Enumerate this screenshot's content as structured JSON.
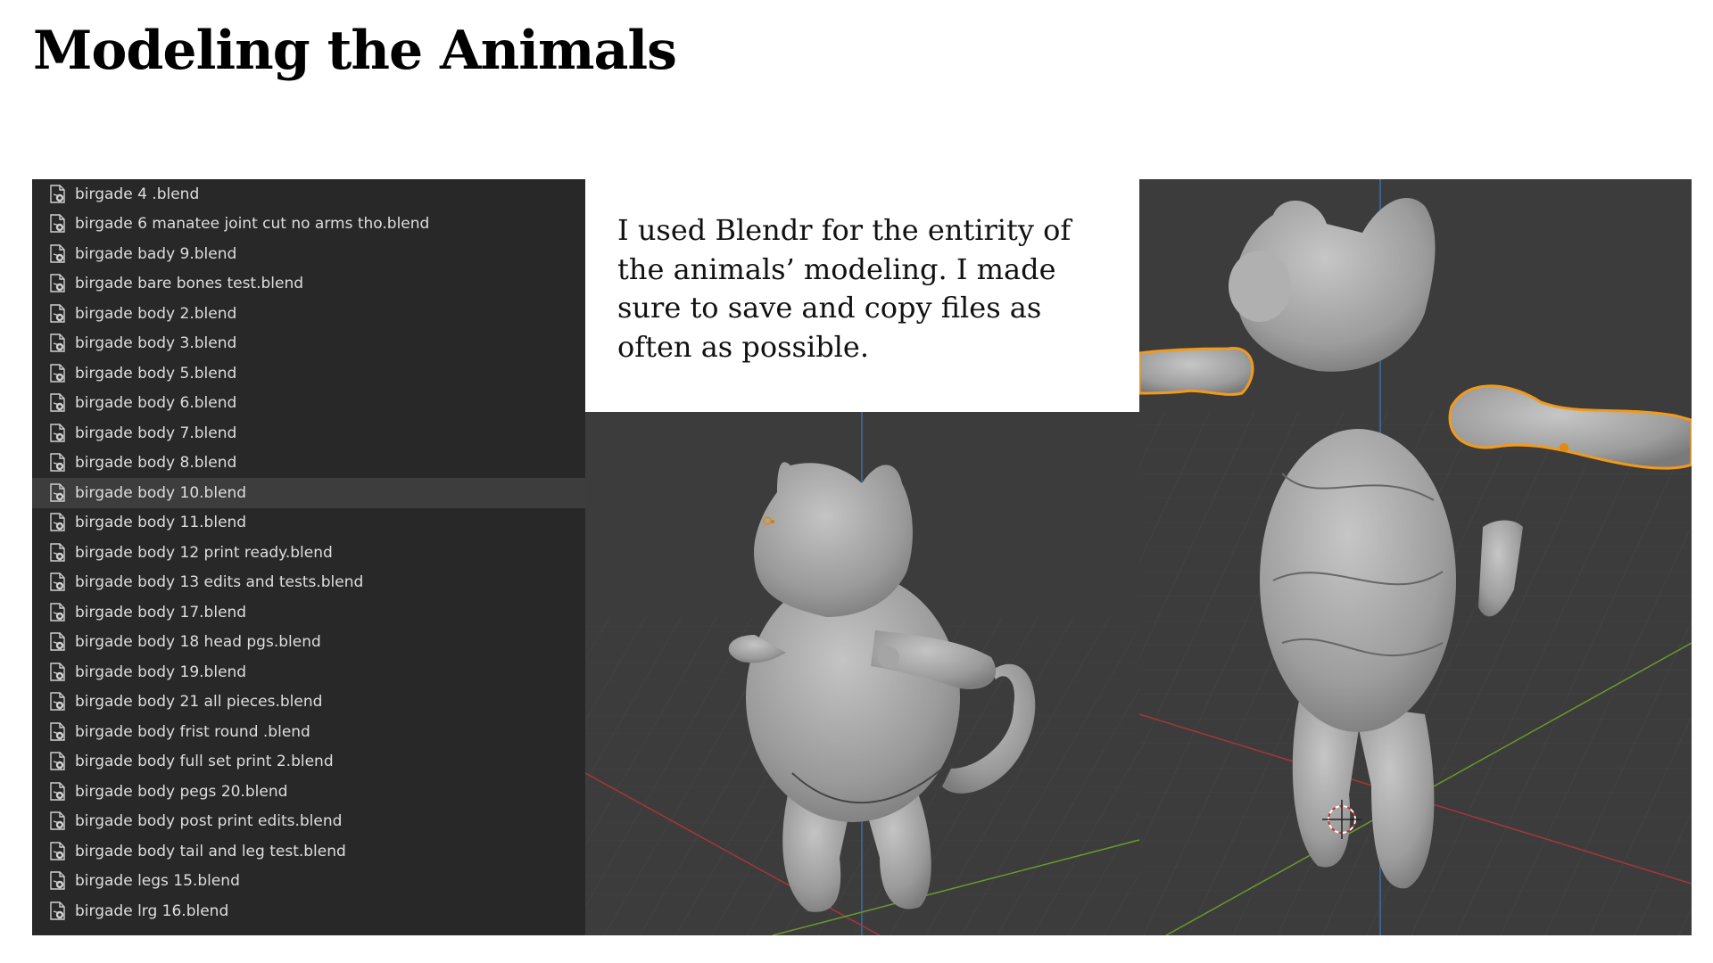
{
  "slide": {
    "title": "Modeling the Animals",
    "caption": "I used Blendr for the entirity of the animals’ modeling. I made sure to save and copy files as often as possible."
  },
  "file_browser": {
    "icon": "blend-file-icon",
    "selected_index": 10,
    "files": [
      "birgade 4 .blend",
      "birgade 6 manatee joint cut no arms tho.blend",
      "birgade bady 9.blend",
      "birgade bare bones test.blend",
      "birgade body 2.blend",
      "birgade body 3.blend",
      "birgade body 5.blend",
      "birgade body 6.blend",
      "birgade body 7.blend",
      "birgade body 8.blend",
      "birgade body 10.blend",
      "birgade body 11.blend",
      "birgade body 12 print ready.blend",
      "birgade body 13 edits and tests.blend",
      "birgade body 17.blend",
      "birgade body 18 head pgs.blend",
      "birgade body 19.blend",
      "birgade body 21 all pieces.blend",
      "birgade body frist round .blend",
      "birgade body full set print 2.blend",
      "birgade body pegs 20.blend",
      "birgade body post print edits.blend",
      "birgade body tail and leg test.blend",
      "birgade legs 15.blend",
      "birgade lrg 16.blend"
    ]
  },
  "colors": {
    "viewport_bg": "#3c3c3c",
    "grid_line": "#4a4a4a",
    "axis_x": "#a8353b",
    "axis_y": "#6a9a2a",
    "axis_z": "#3b6ea8",
    "selection_outline": "#f29a1a",
    "model_gray": "#a9a9a9"
  }
}
